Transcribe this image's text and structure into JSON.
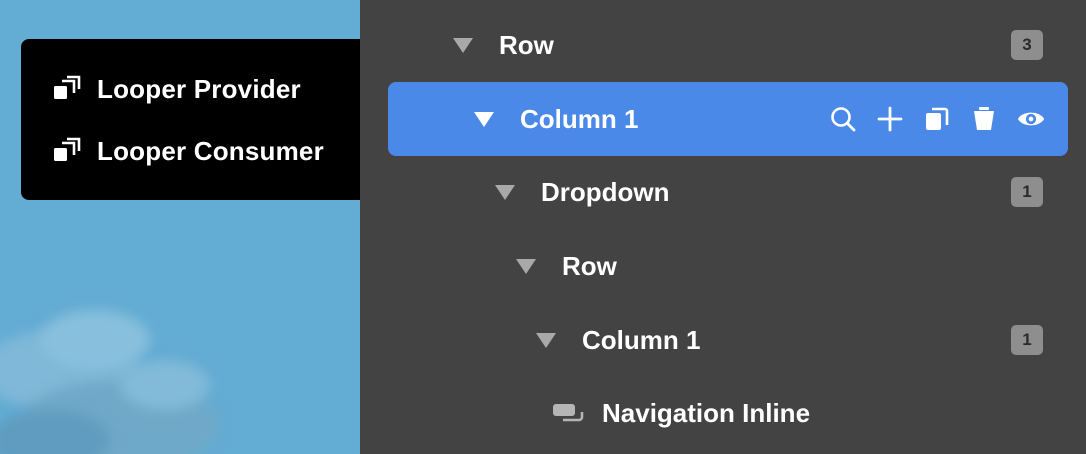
{
  "popup": {
    "items": [
      {
        "label": "Looper Provider",
        "icon": "copy-stack-icon"
      },
      {
        "label": "Looper Consumer",
        "icon": "copy-stack-icon"
      }
    ]
  },
  "navigator": {
    "rows": [
      {
        "label": "Row",
        "badge": "3"
      },
      {
        "label": "Column 1",
        "badge": ""
      },
      {
        "label": "Dropdown",
        "badge": "1"
      },
      {
        "label": "Row",
        "badge": ""
      },
      {
        "label": "Column 1",
        "badge": "1"
      },
      {
        "label": "Navigation Inline",
        "badge": ""
      }
    ],
    "selected_actions": [
      "search-icon",
      "plus-icon",
      "duplicate-icon",
      "trash-icon",
      "eye-icon"
    ]
  },
  "colors": {
    "panel_bg": "#434343",
    "selection": "#4a89e8",
    "popup_bg": "#000000",
    "badge_bg": "#8e8e8e",
    "canvas_bg": "#63acd4"
  }
}
